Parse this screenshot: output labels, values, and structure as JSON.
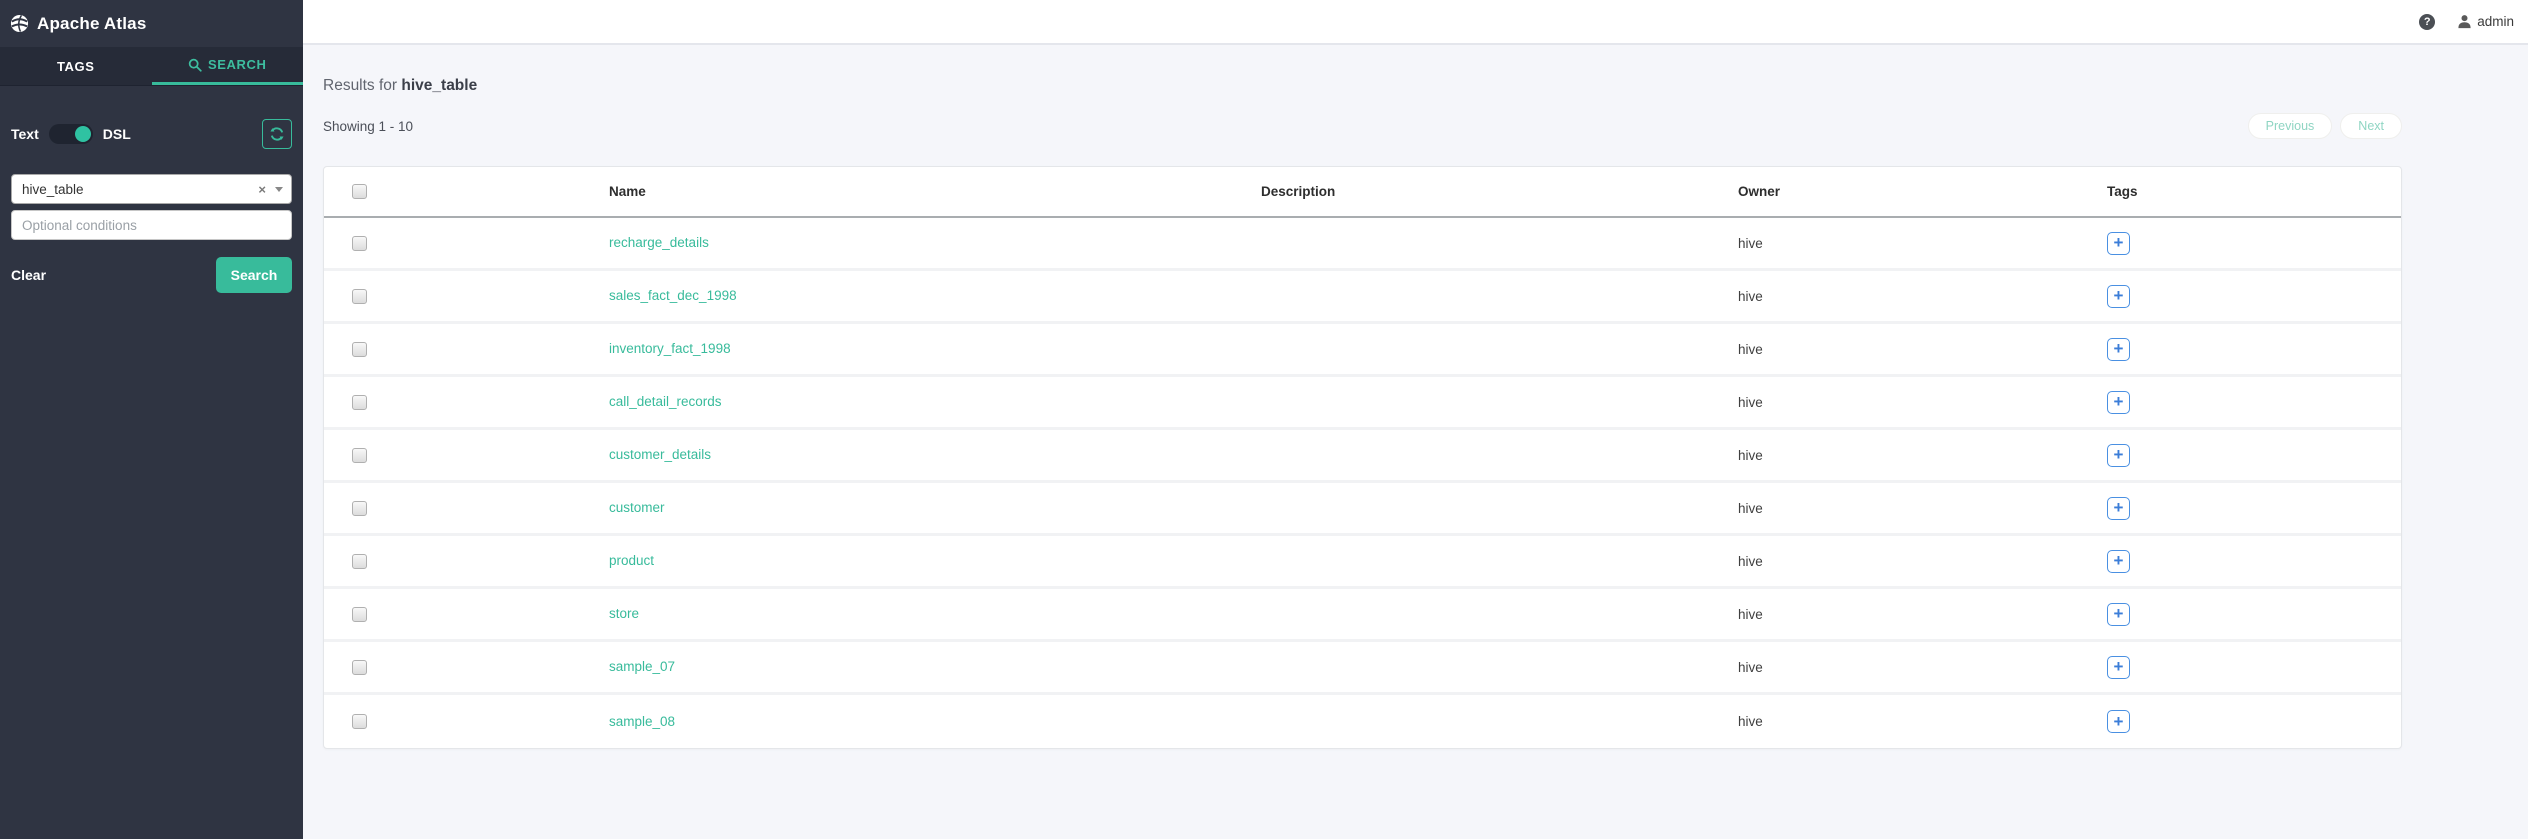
{
  "app": {
    "title": "Apache Atlas"
  },
  "topbar": {
    "user": "admin",
    "help_glyph": "?"
  },
  "sidebar": {
    "tabs": [
      {
        "label": "TAGS"
      },
      {
        "label": "SEARCH"
      }
    ],
    "search_mode": {
      "left_label": "Text",
      "right_label": "DSL",
      "selected": "DSL"
    },
    "query_input": {
      "value": "hive_table"
    },
    "conditions_input": {
      "placeholder": "Optional conditions"
    },
    "clear_label": "Clear",
    "search_button_label": "Search"
  },
  "results": {
    "title_prefix": "Results for ",
    "title_query": "hive_table",
    "showing": "Showing 1 - 10",
    "pagination": {
      "previous": "Previous",
      "next": "Next"
    }
  },
  "table": {
    "headers": [
      "Name",
      "Description",
      "Owner",
      "Tags"
    ],
    "add_tag_glyph": "+",
    "rows": [
      {
        "name": "recharge_details",
        "description": "",
        "owner": "hive"
      },
      {
        "name": "sales_fact_dec_1998",
        "description": "",
        "owner": "hive"
      },
      {
        "name": "inventory_fact_1998",
        "description": "",
        "owner": "hive"
      },
      {
        "name": "call_detail_records",
        "description": "",
        "owner": "hive"
      },
      {
        "name": "customer_details",
        "description": "",
        "owner": "hive"
      },
      {
        "name": "customer",
        "description": "",
        "owner": "hive"
      },
      {
        "name": "product",
        "description": "",
        "owner": "hive"
      },
      {
        "name": "store",
        "description": "",
        "owner": "hive"
      },
      {
        "name": "sample_07",
        "description": "",
        "owner": "hive"
      },
      {
        "name": "sample_08",
        "description": "",
        "owner": "hive"
      }
    ]
  },
  "colors": {
    "accent_teal": "#38bb9b",
    "sidebar_bg": "#2f3442",
    "tabbar_bg": "#262b38",
    "link": "#38bb9b",
    "tag_button_blue": "#4a90e2",
    "main_bg": "#f5f6fa"
  }
}
